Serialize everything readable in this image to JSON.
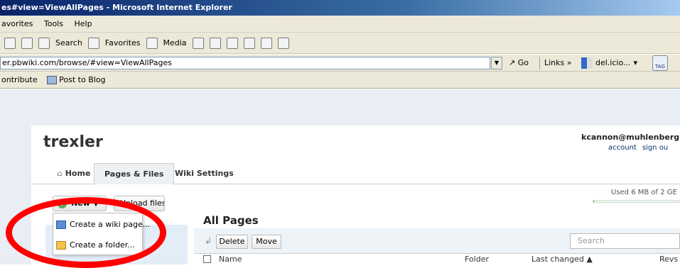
{
  "window": {
    "title": "es#view=ViewAllPages - Microsoft Internet Explorer"
  },
  "menu": {
    "items": [
      "avorites",
      "Tools",
      "Help"
    ]
  },
  "toolbar": {
    "search": "Search",
    "favorites": "Favorites",
    "media": "Media"
  },
  "address": {
    "url": "er.pbwiki.com/browse/#view=ViewAllPages",
    "go": "Go",
    "links": "Links",
    "delicious": "del.icio...",
    "tag": "TAG"
  },
  "linkbar": {
    "contribute": "ontribute",
    "post": "Post to Blog"
  },
  "wiki": {
    "title": "trexler",
    "user": "kcannon@muhlenberg.ed",
    "account": "account",
    "signout": "sign ou",
    "usage": "Used 6 MB of 2 GE",
    "usage_fraction": 0.003
  },
  "tabs": {
    "home": "Home",
    "pages": "Pages & Files",
    "settings": "Wiki Settings"
  },
  "actions": {
    "new": "New",
    "upload": "Upload files",
    "dropdown": {
      "create_page": "Create a wiki page...",
      "create_folder": "Create a folder..."
    }
  },
  "list": {
    "heading": "All Pages",
    "delete": "Delete",
    "move": "Move",
    "search_placeholder": "Search",
    "columns": {
      "name": "Name",
      "folder": "Folder",
      "last_changed": "Last changed ▲",
      "revs": "Revs"
    }
  },
  "colors": {
    "annotation": "#ff0000"
  }
}
